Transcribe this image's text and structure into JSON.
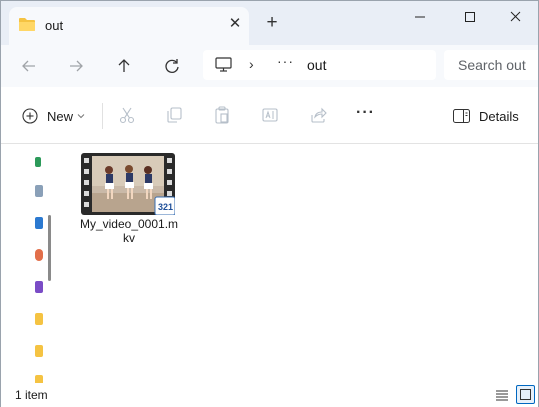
{
  "tab": {
    "title": "out",
    "icon": "folder-icon",
    "close_glyph": "✕"
  },
  "new_tab_glyph": "+",
  "window_controls": {
    "minimize": "—",
    "maximize": "☐",
    "close": "✕"
  },
  "address": {
    "separator": "›",
    "overflow": "···",
    "current": "out"
  },
  "search": {
    "placeholder": "Search out"
  },
  "commands": {
    "new_label": "New",
    "more_glyph": "···",
    "details_label": "Details"
  },
  "files": [
    {
      "name": "My_video_0001.mkv",
      "type": "video",
      "badge": "321"
    }
  ],
  "status": {
    "item_count": "1 item"
  },
  "colors": {
    "accent": "#0067c0",
    "folder": "#f5c342",
    "titlebar": "#e9eef6"
  }
}
